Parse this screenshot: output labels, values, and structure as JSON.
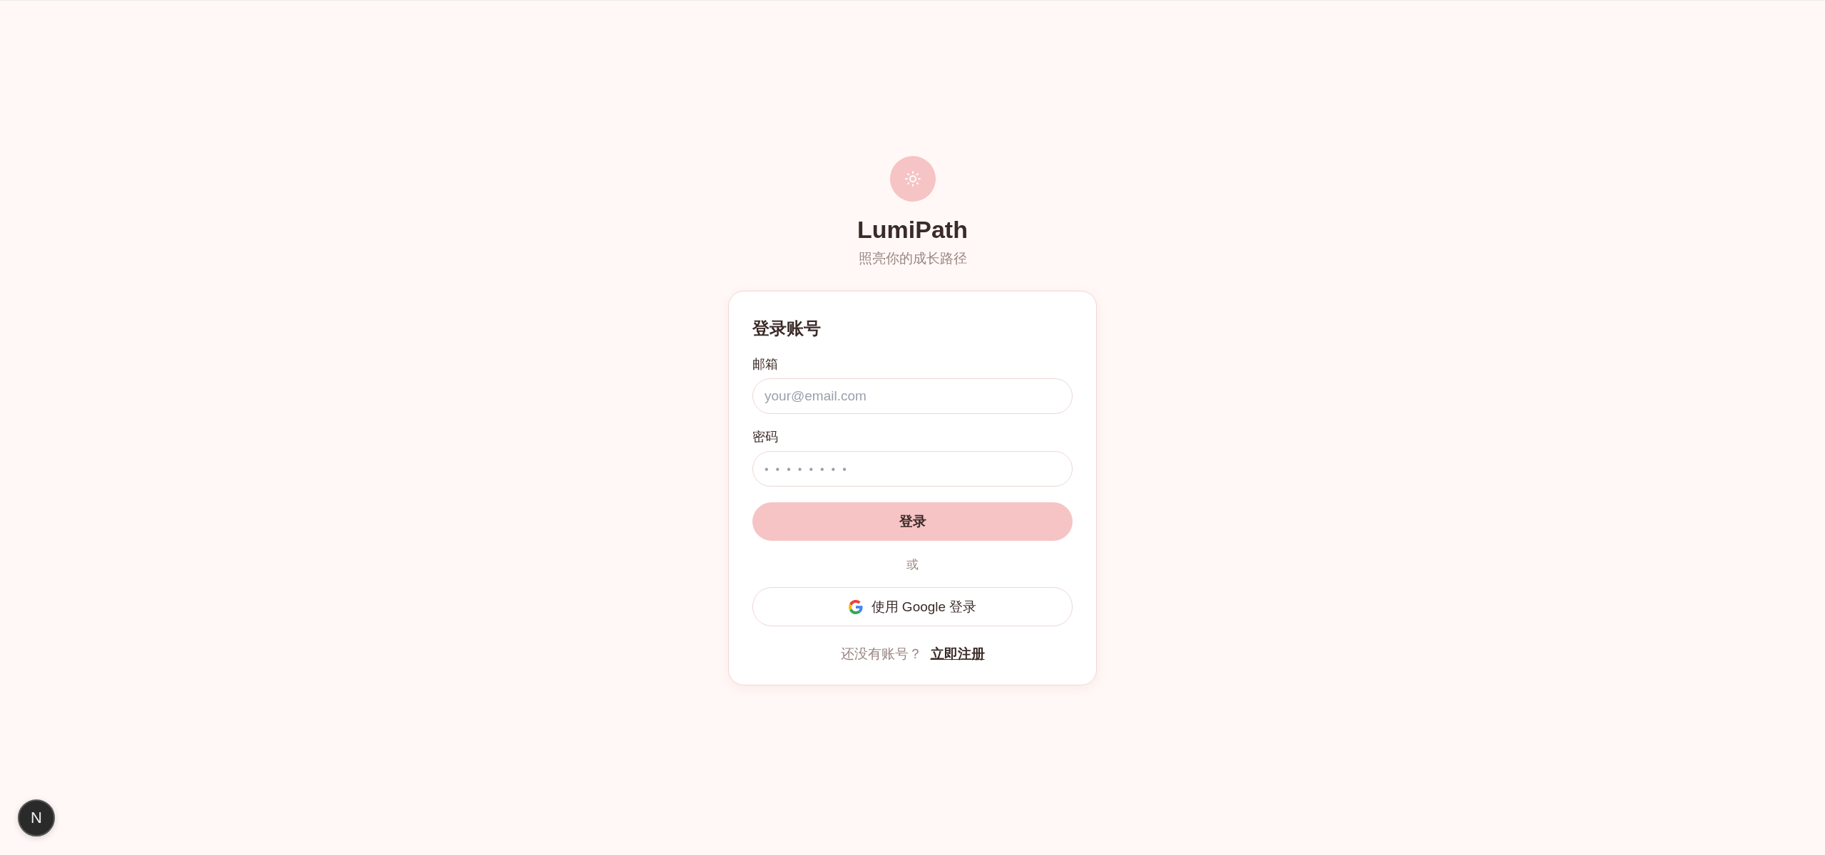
{
  "brand": {
    "name": "LumiPath",
    "tagline": "照亮你的成长路径"
  },
  "card": {
    "title": "登录账号",
    "fields": [
      {
        "label": "邮箱",
        "placeholder": "your@email.com",
        "kind": "email"
      },
      {
        "label": "密码",
        "placeholder": "••••••••",
        "kind": "password"
      }
    ],
    "submit": "登录",
    "divider": "或",
    "google_button": "使用 Google 登录",
    "footer": {
      "text": "还没有账号？",
      "link": "立即注册"
    }
  },
  "dev_badge": {
    "label": "N"
  }
}
